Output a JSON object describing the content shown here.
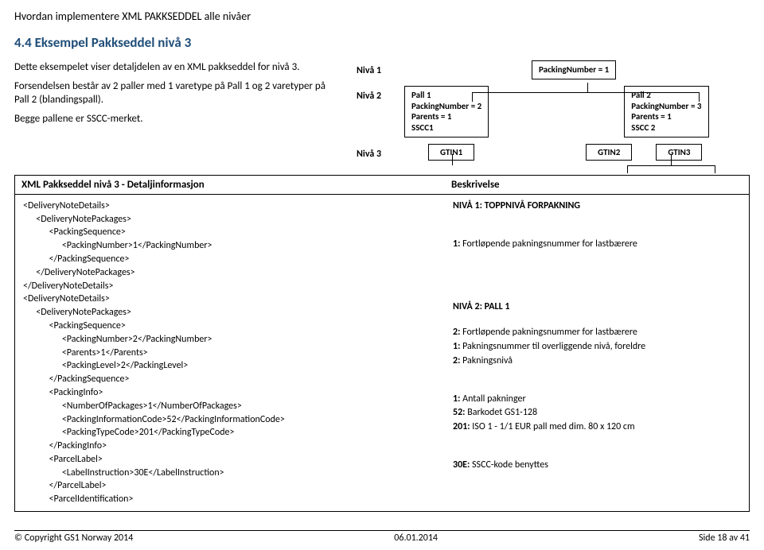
{
  "header": "Hvordan implementere XML PAKKSEDDEL alle nivåer",
  "section": "4.4   Eksempel Pakkseddel nivå 3",
  "intro": {
    "p1": "Dette eksempelet viser detaljdelen av en XML pakkseddel for nivå 3.",
    "p2": "Forsendelsen består av 2 paller med 1 varetype på Pall 1 og 2 varetyper på Pall 2 (blandingspall).",
    "p3": "Begge pallene er SSCC-merket."
  },
  "diagram": {
    "n1": "Nivå 1",
    "n2": "Nivå 2",
    "n3": "Nivå 3",
    "pn1": "PackingNumber = 1",
    "pall1_title": "Pall 1",
    "pall1_l2": "PackingNumber = 2",
    "pall1_l3": "Parents = 1",
    "pall1_l4": "SSCC1",
    "pall2_title": "Pall 2",
    "pall2_l2": "PackingNumber = 3",
    "pall2_l3": "Parents = 1",
    "pall2_l4": "SSCC 2",
    "g1": "GTIN1",
    "g2": "GTIN2",
    "g3": "GTIN3"
  },
  "table": {
    "h1": "XML Pakkseddel nivå 3 - Detaljinformasjon",
    "h2": "Beskrivelse",
    "xml": "<DeliveryNoteDetails>\n      <DeliveryNotePackages>\n            <PackingSequence>\n                  <PackingNumber>1</PackingNumber>\n            </PackingSequence>\n      </DeliveryNotePackages>\n</DeliveryNoteDetails>\n<DeliveryNoteDetails>\n      <DeliveryNotePackages>\n            <PackingSequence>\n                  <PackingNumber>2</PackingNumber>\n                  <Parents>1</Parents>\n                  <PackingLevel>2</PackingLevel>\n            </PackingSequence>\n            <PackingInfo>\n                  <NumberOfPackages>1</NumberOfPackages>\n                  <PackingInformationCode>52</PackingInformationCode>\n                  <PackingTypeCode>201</PackingTypeCode>\n            </PackingInfo>\n            <ParcelLabel>\n                  <LabelInstruction>30E</LabelInstruction>\n            </ParcelLabel>\n            <ParcelIdentification>",
    "desc": {
      "d1": "NIVÅ 1: TOPPNIVÅ FORPAKNING",
      "d2": "1: Fortløpende pakningsnummer for lastbærere",
      "d3": "NIVÅ 2: PALL 1",
      "d4": "2: Fortløpende pakningsnummer for lastbærere",
      "d5": "1: Pakningsnummer til overliggende nivå, foreldre",
      "d6": "2: Pakningsnivå",
      "d7": "1: Antall pakninger",
      "d8": "52: Barkodet GS1-128",
      "d9": "201: ISO 1 - 1/1 EUR pall med dim. 80 x 120 cm",
      "d10": "30E: SSCC-kode benyttes"
    }
  },
  "footer": {
    "left": "© Copyright GS1 Norway 2014",
    "center": "06.01.2014",
    "right": "Side 18 av 41"
  }
}
